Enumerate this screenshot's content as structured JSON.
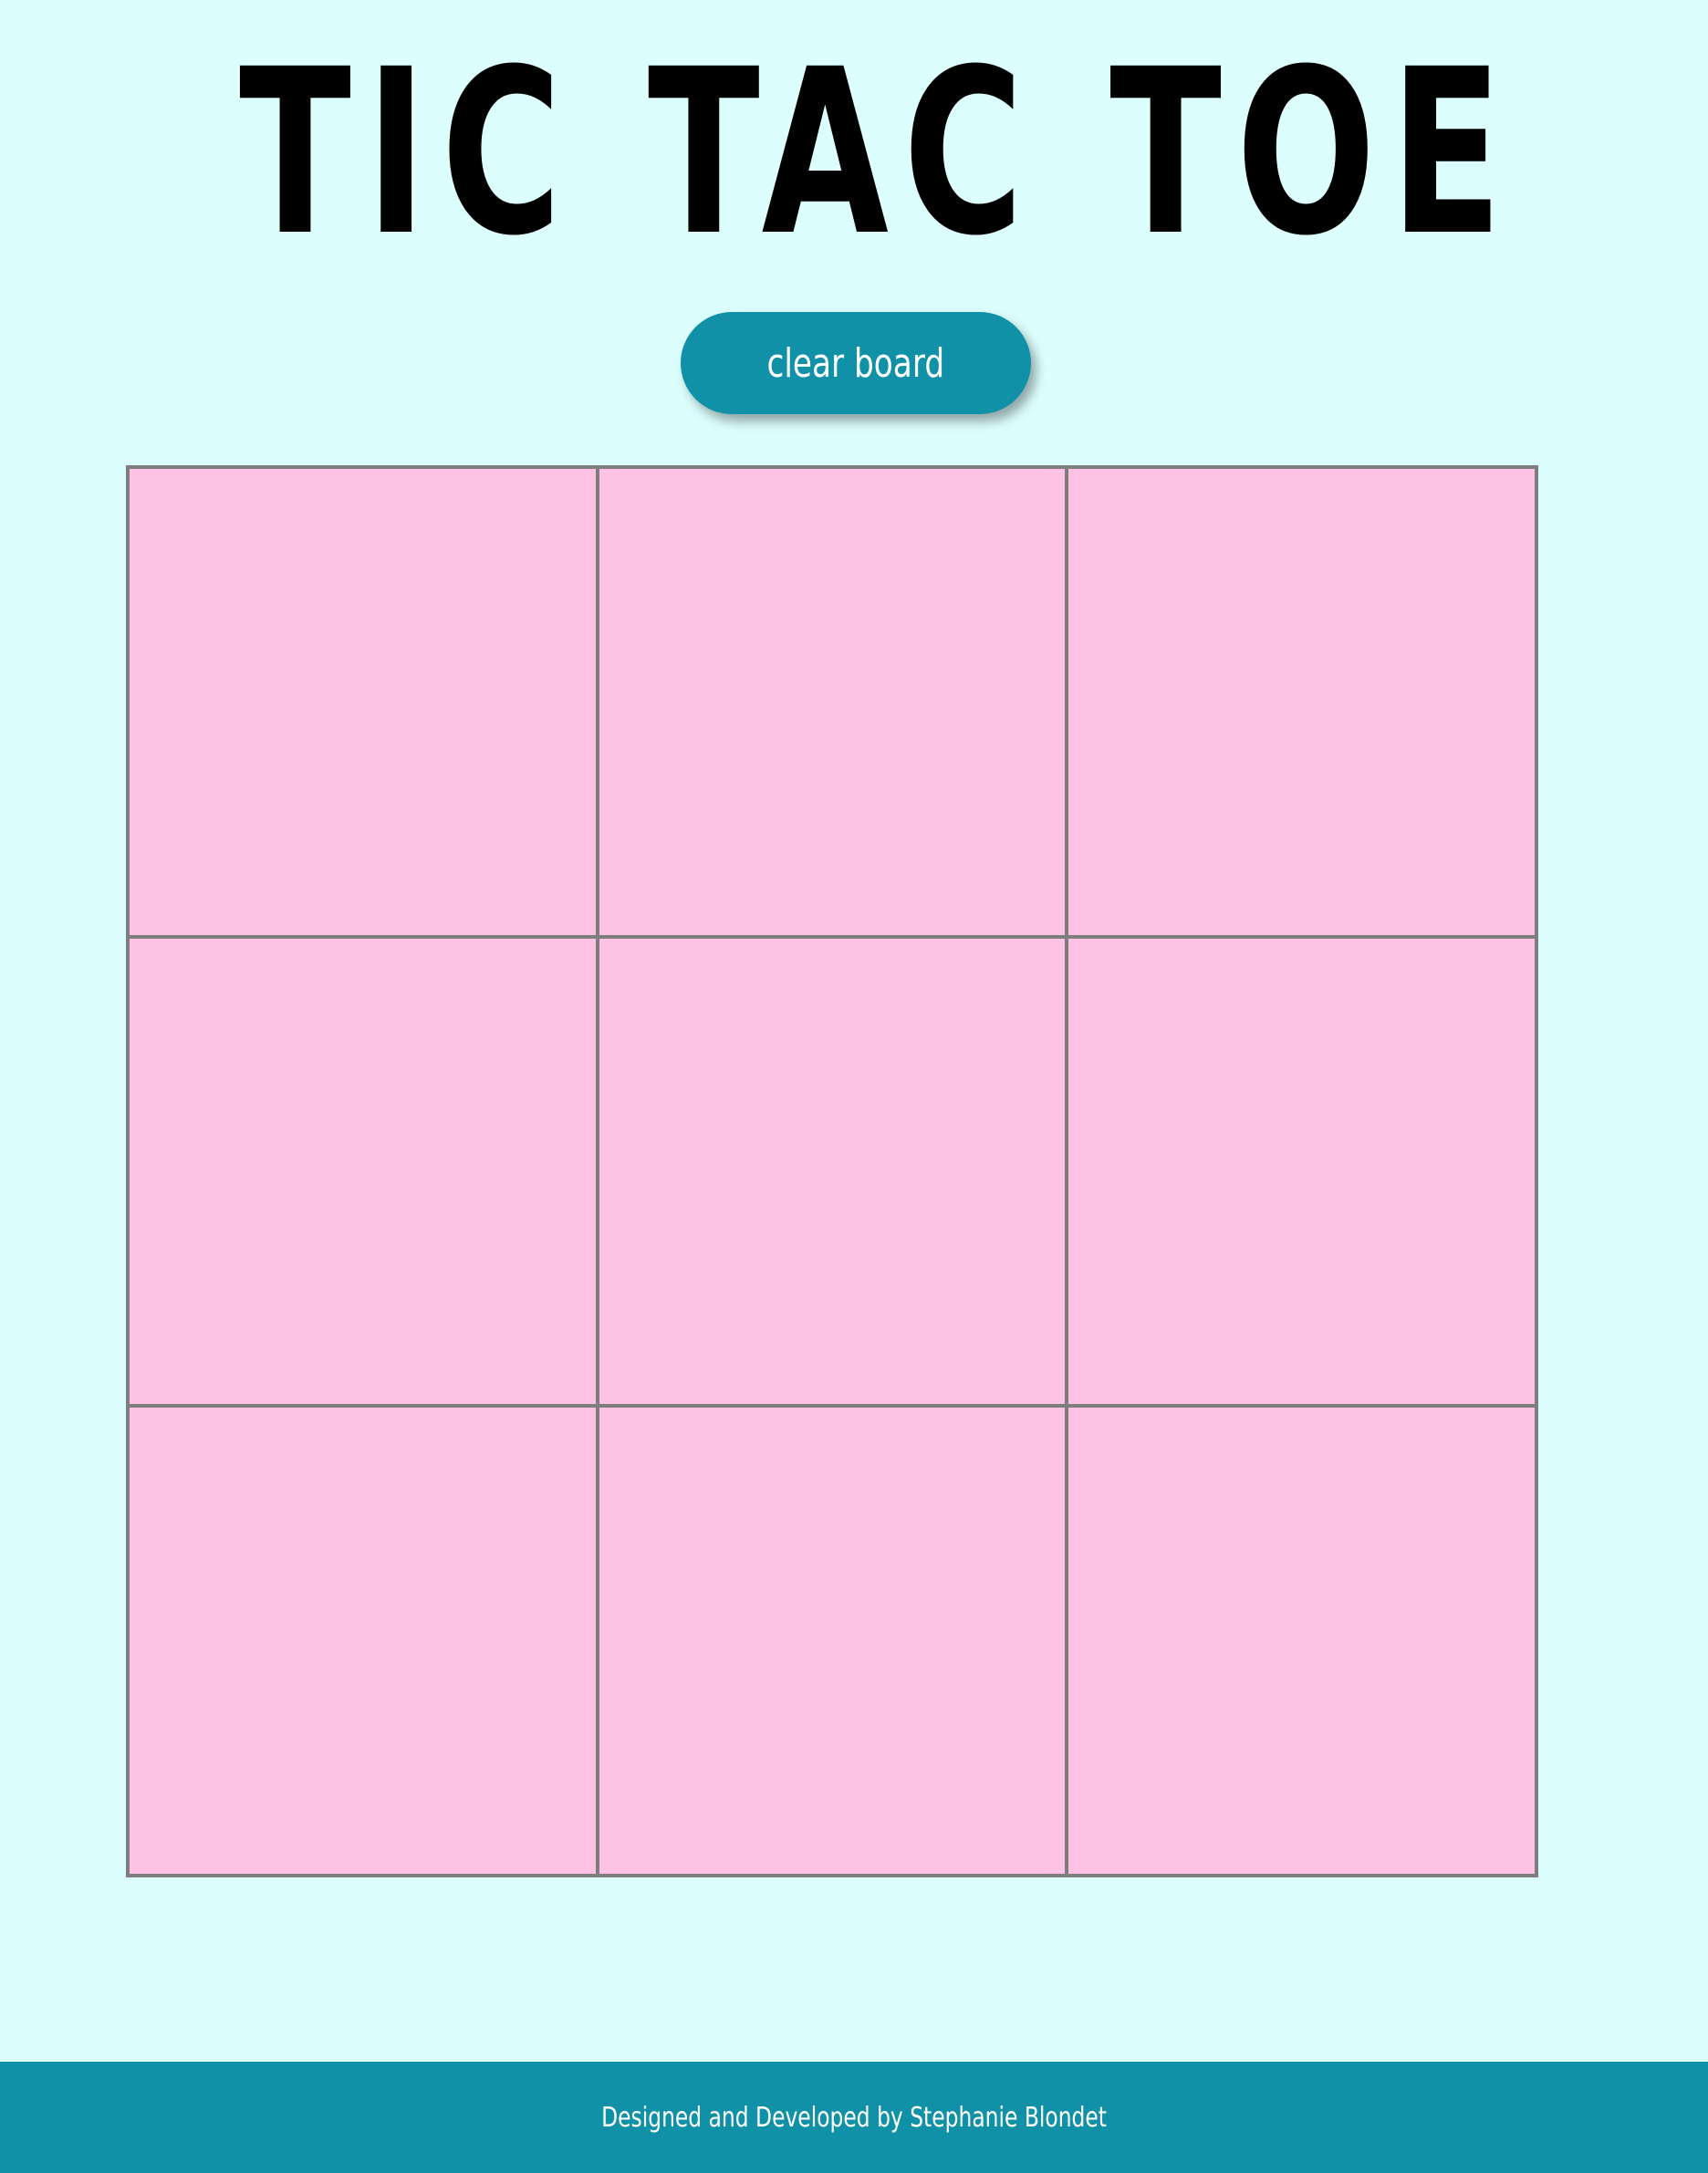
{
  "header": {
    "title": "TIC TAC TOE"
  },
  "controls": {
    "clear_label": "clear board"
  },
  "board": {
    "cells": [
      "",
      "",
      "",
      "",
      "",
      "",
      "",
      "",
      ""
    ]
  },
  "footer": {
    "credit": "Designed and Developed by Stephanie Blondet"
  },
  "colors": {
    "background": "#dcfffe",
    "accent": "#1091a8",
    "cell": "#fec2e5",
    "grid_line": "#7e7e7e"
  }
}
